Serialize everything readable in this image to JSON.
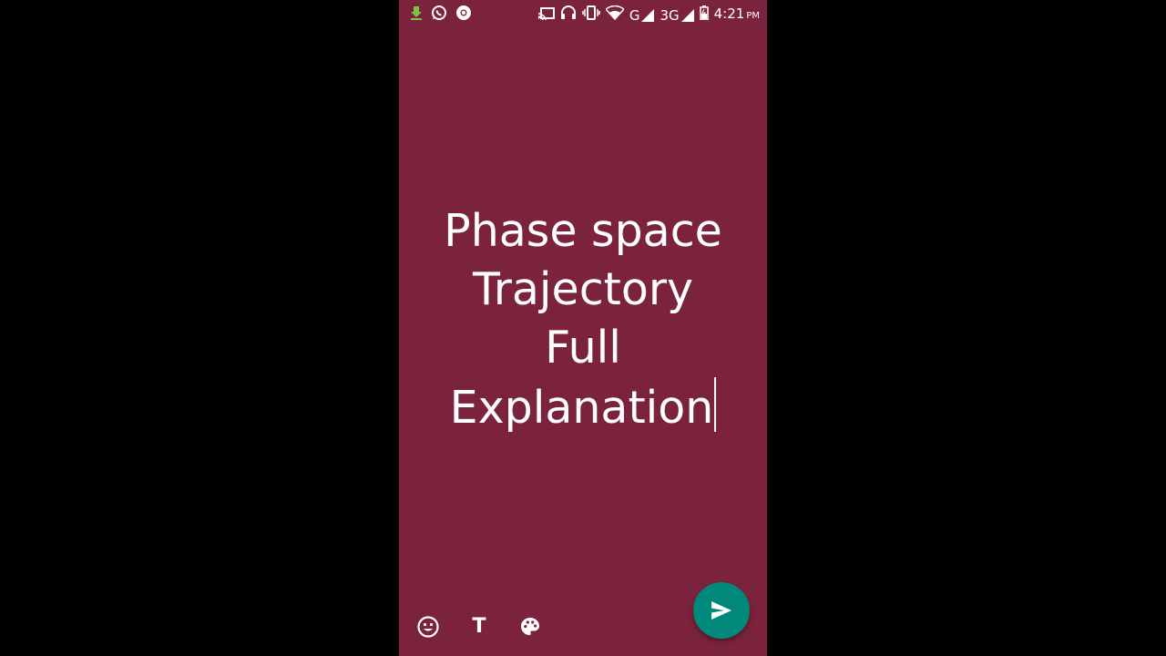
{
  "status_bar": {
    "time": "4:21",
    "ampm": "PM",
    "network_1": "G",
    "network_2": "3G",
    "left_icons": [
      "download-icon",
      "whatsapp-icon",
      "chrome-icon"
    ],
    "right_icons": [
      "cast-icon",
      "headset-icon",
      "vibrate-icon",
      "wifi-icon",
      "signal-icon",
      "signal-icon",
      "battery-icon"
    ]
  },
  "status_text": {
    "lines": [
      "Phase space",
      "Trajectory",
      "Full",
      "Explanation"
    ]
  },
  "toolbar": {
    "tools": [
      "emoji-icon",
      "text-style-icon",
      "palette-icon"
    ],
    "text_tool_label": "T",
    "send_icon": "send-icon"
  },
  "colors": {
    "background": "#7b233c",
    "send_button": "#00897b",
    "text": "#ffffff"
  }
}
